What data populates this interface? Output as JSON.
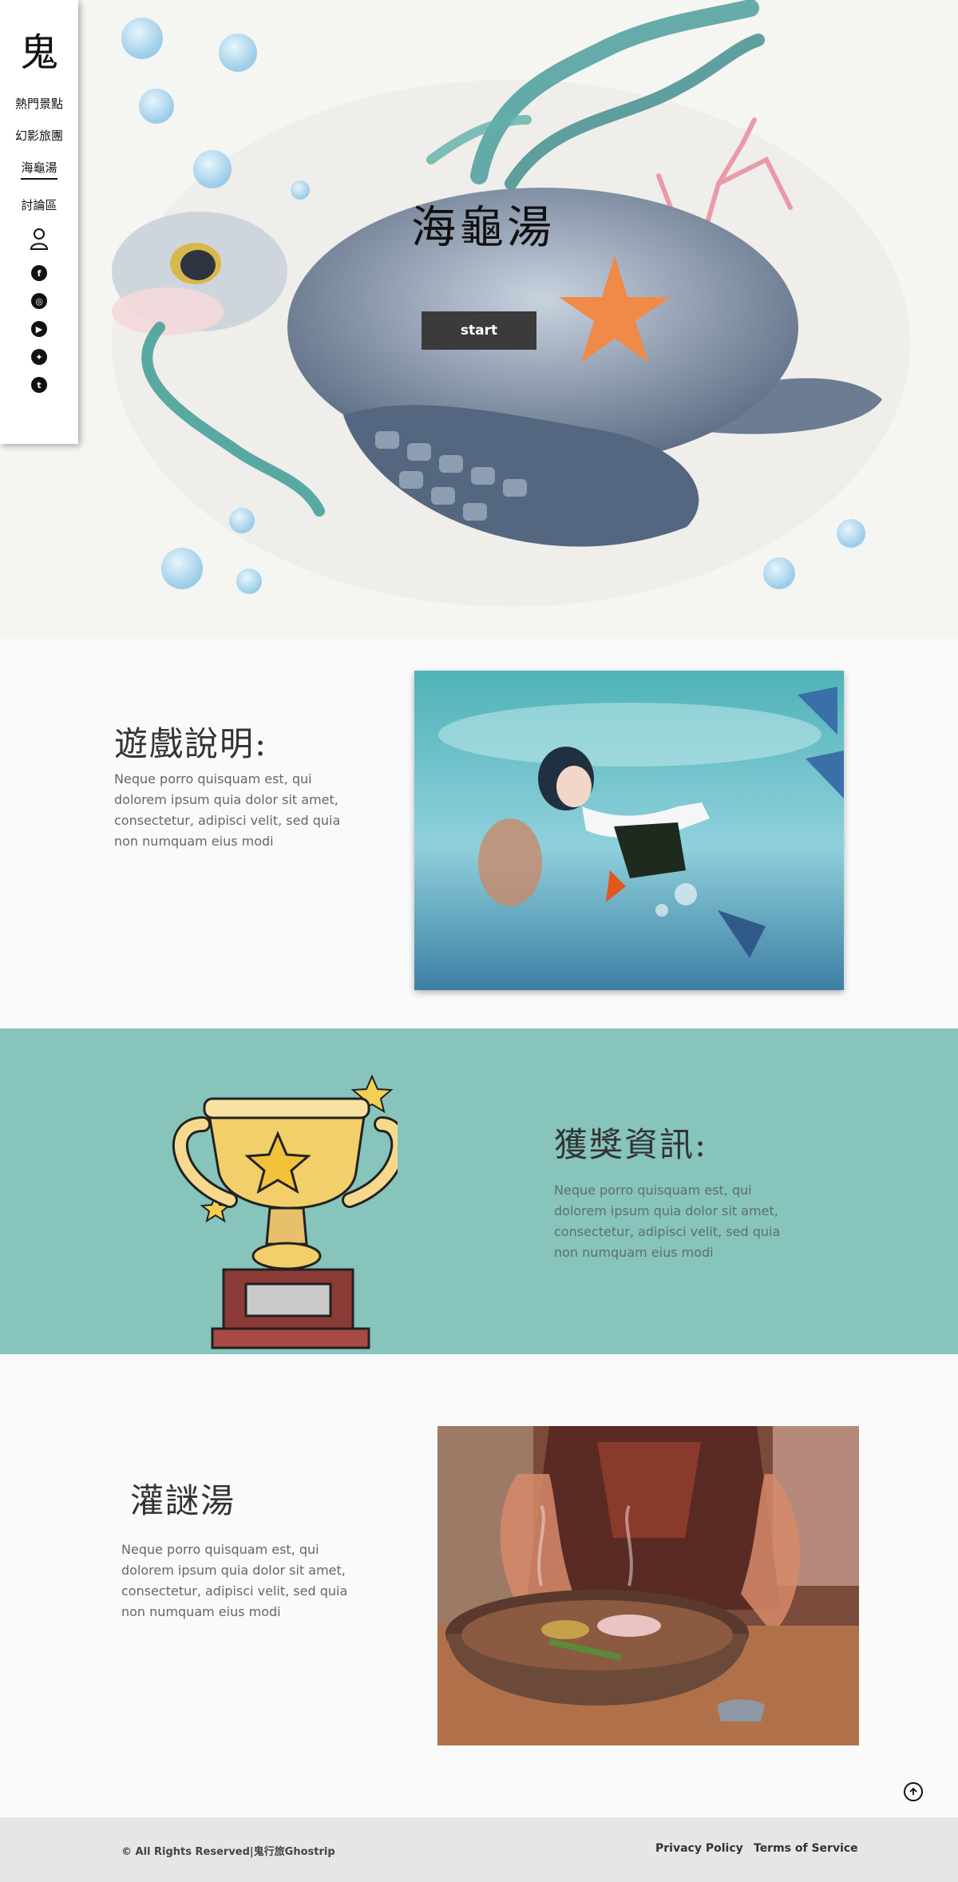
{
  "brand": {
    "logo": "鬼"
  },
  "sidebar": {
    "items": [
      {
        "label": "熱門景點"
      },
      {
        "label": "幻影旅團"
      },
      {
        "label": "海龜湯"
      },
      {
        "label": "討論區"
      }
    ],
    "social": [
      {
        "icon": "facebook-icon",
        "glyph": "f"
      },
      {
        "icon": "instagram-icon",
        "glyph": "◎"
      },
      {
        "icon": "youtube-icon",
        "glyph": "▶"
      },
      {
        "icon": "twitter-icon",
        "glyph": "✦"
      },
      {
        "icon": "tumblr-icon",
        "glyph": "t"
      }
    ]
  },
  "hero": {
    "title": "海龜湯",
    "button_label": "start"
  },
  "section1": {
    "heading": "遊戲說明:",
    "text": "Neque porro quisquam est, qui dolorem ipsum quia dolor sit amet, consectetur, adipisci velit, sed quia non numquam eius modi"
  },
  "section2": {
    "heading": "獲獎資訊:",
    "text": "Neque porro quisquam est, qui dolorem ipsum quia dolor sit amet, consectetur, adipisci velit, sed quia non numquam eius modi"
  },
  "section3": {
    "heading": "灌謎湯",
    "text": "Neque porro quisquam est, qui dolorem ipsum quia dolor sit amet, consectetur, adipisci velit, sed quia non numquam eius modi"
  },
  "footer": {
    "copyright": "©  All Rights Reserved|鬼行旅Ghostrip",
    "privacy": "Privacy Policy",
    "terms": "Terms of Service"
  },
  "colors": {
    "teal_band": "#86c4bc",
    "button": "#3b3b3b",
    "footer": "#e6e6e6"
  }
}
